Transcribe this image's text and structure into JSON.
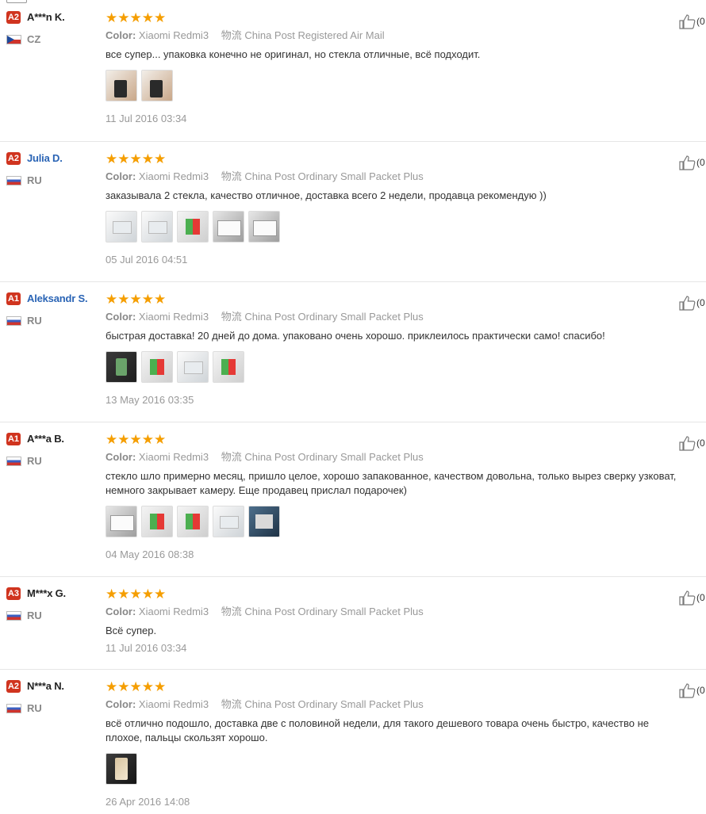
{
  "labels": {
    "color": "Color:",
    "shipping": "物流"
  },
  "colors": {
    "level_badge": "#d0341f",
    "star": "#f59e00",
    "link_name": "#2a64b5"
  },
  "reviews": [
    {
      "level": "A2",
      "name": "A***n K.",
      "country": "CZ",
      "flag": "cz-flag-icon",
      "stars": "★★★★★",
      "rating": 5,
      "color": "Xiaomi Redmi3",
      "shipping": "China Post Registered Air Mail",
      "text": "все супер... упаковка конечно не оригинал, но стекла отличные, всё подходит.",
      "photo_count": 2,
      "date": "11 Jul 2016 03:34",
      "likes": "(0"
    },
    {
      "level": "A2",
      "name": "Julia D.",
      "country": "RU",
      "flag": "ru-flag-icon",
      "stars": "★★★★★",
      "rating": 5,
      "color": "Xiaomi Redmi3",
      "shipping": "China Post Ordinary Small Packet Plus",
      "text": "заказывала 2 стекла, качество отличное, доставка всего 2 недели, продавца рекомендую ))",
      "photo_count": 5,
      "date": "05 Jul 2016 04:51",
      "likes": "(0"
    },
    {
      "level": "A1",
      "name": "Aleksandr S.",
      "country": "RU",
      "flag": "ru-flag-icon",
      "stars": "★★★★★",
      "rating": 5,
      "color": "Xiaomi Redmi3",
      "shipping": "China Post Ordinary Small Packet Plus",
      "text": "быстрая доставка! 20 дней до дома. упаковано очень хорошо. приклеилось практически само! спасибо!",
      "photo_count": 4,
      "date": "13 May 2016 03:35",
      "likes": "(0"
    },
    {
      "level": "A1",
      "name": "A***a B.",
      "country": "RU",
      "flag": "ru-flag-icon",
      "stars": "★★★★★",
      "rating": 5,
      "color": "Xiaomi Redmi3",
      "shipping": "China Post Ordinary Small Packet Plus",
      "text": "стекло шло примерно месяц, пришло целое, хорошо запакованное, качеством довольна, только вырез сверку узковат,\nнемного закрывает камеру. Еще продавец прислал подарочек)",
      "photo_count": 5,
      "date": "04 May 2016 08:38",
      "likes": "(0"
    },
    {
      "level": "A3",
      "name": "M***x G.",
      "country": "RU",
      "flag": "ru-flag-icon",
      "stars": "★★★★★",
      "rating": 5,
      "color": "Xiaomi Redmi3",
      "shipping": "China Post Ordinary Small Packet Plus",
      "text": "Всё супер.",
      "photo_count": 0,
      "date": "11 Jul 2016 03:34",
      "likes": "(0"
    },
    {
      "level": "A2",
      "name": "N***a N.",
      "country": "RU",
      "flag": "ru-flag-icon",
      "stars": "★★★★★",
      "rating": 5,
      "color": "Xiaomi Redmi3",
      "shipping": "China Post Ordinary Small Packet Plus",
      "text": "всё отлично подошло, доставка две с половиной недели, для такого дешевого товара очень быстро, качество не\nплохое, пальцы скользят хорошо.",
      "photo_count": 1,
      "date": "26 Apr 2016 14:08",
      "likes": "(0"
    }
  ]
}
